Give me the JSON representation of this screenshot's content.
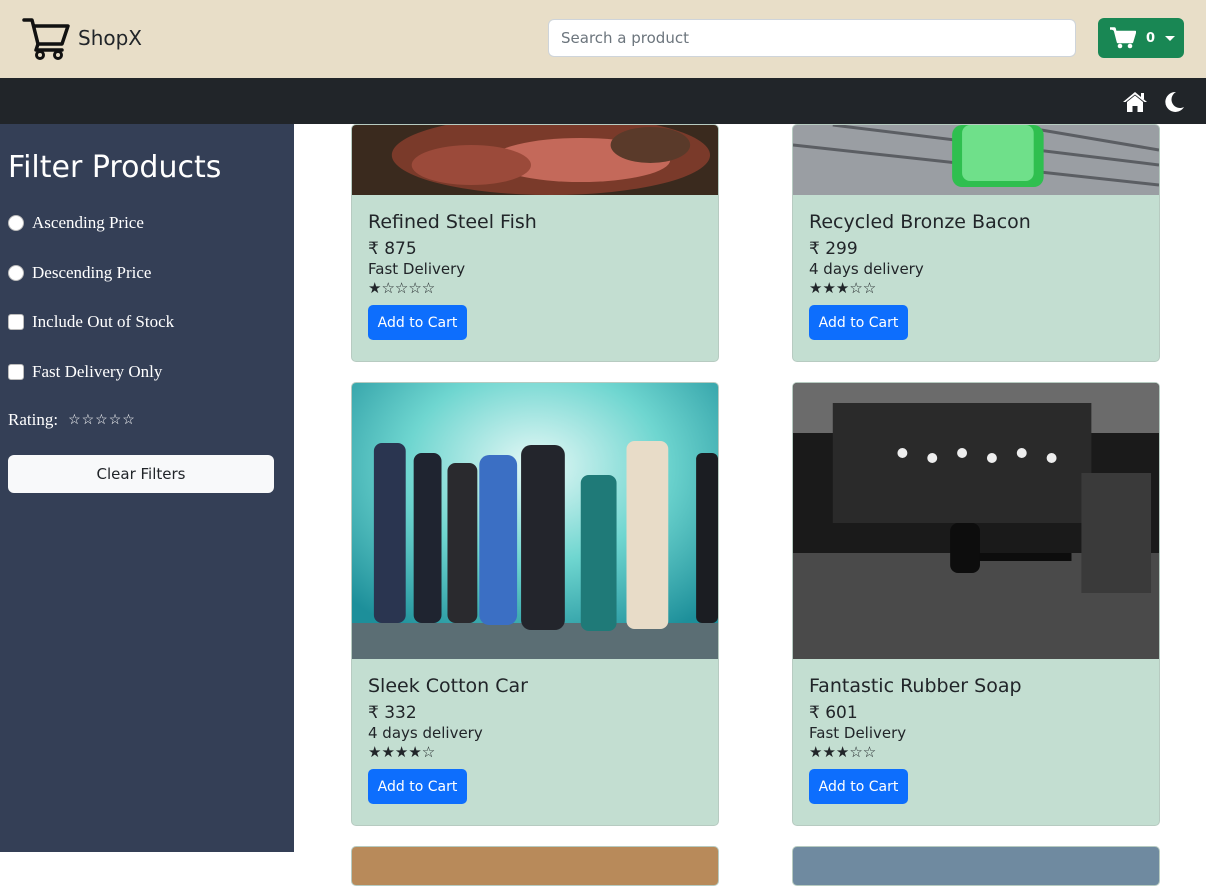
{
  "brand": {
    "name": "ShopX",
    "icon": "cart-outline-icon"
  },
  "search": {
    "placeholder": "Search a product",
    "value": ""
  },
  "cart": {
    "count": "0",
    "icon": "cart-icon"
  },
  "nav": {
    "home_icon": "home-icon",
    "theme_icon": "moon-icon"
  },
  "sidebar": {
    "title": "Filter Products",
    "options": [
      {
        "label": "Ascending Price",
        "type": "radio",
        "checked": false
      },
      {
        "label": "Descending Price",
        "type": "radio",
        "checked": false
      },
      {
        "label": "Include Out of Stock",
        "type": "checkbox",
        "checked": false
      },
      {
        "label": "Fast Delivery Only",
        "type": "checkbox",
        "checked": false
      }
    ],
    "rating_label": "Rating:",
    "rating_stars": "☆☆☆☆☆",
    "rating_value": 0,
    "clear_label": "Clear Filters"
  },
  "products": [
    {
      "name": "Refined Steel Fish",
      "price": "₹ 875",
      "delivery": "Fast Delivery",
      "stars": "★☆☆☆☆",
      "rating": 1,
      "button": "Add to Cart"
    },
    {
      "name": "Recycled Bronze Bacon",
      "price": "₹ 299",
      "delivery": "4 days delivery",
      "stars": "★★★☆☆",
      "rating": 3,
      "button": "Add to Cart"
    },
    {
      "name": "Sleek Cotton Car",
      "price": "₹ 332",
      "delivery": "4 days delivery",
      "stars": "★★★★☆",
      "rating": 4,
      "button": "Add to Cart"
    },
    {
      "name": "Fantastic Rubber Soap",
      "price": "₹ 601",
      "delivery": "Fast Delivery",
      "stars": "★★★☆☆",
      "rating": 3,
      "button": "Add to Cart"
    }
  ],
  "colors": {
    "topbar": "#e8dec8",
    "navbar": "#212529",
    "sidebar": "#343f56",
    "card": "#c3ded1",
    "primary": "#0d6efd",
    "success": "#198754"
  }
}
